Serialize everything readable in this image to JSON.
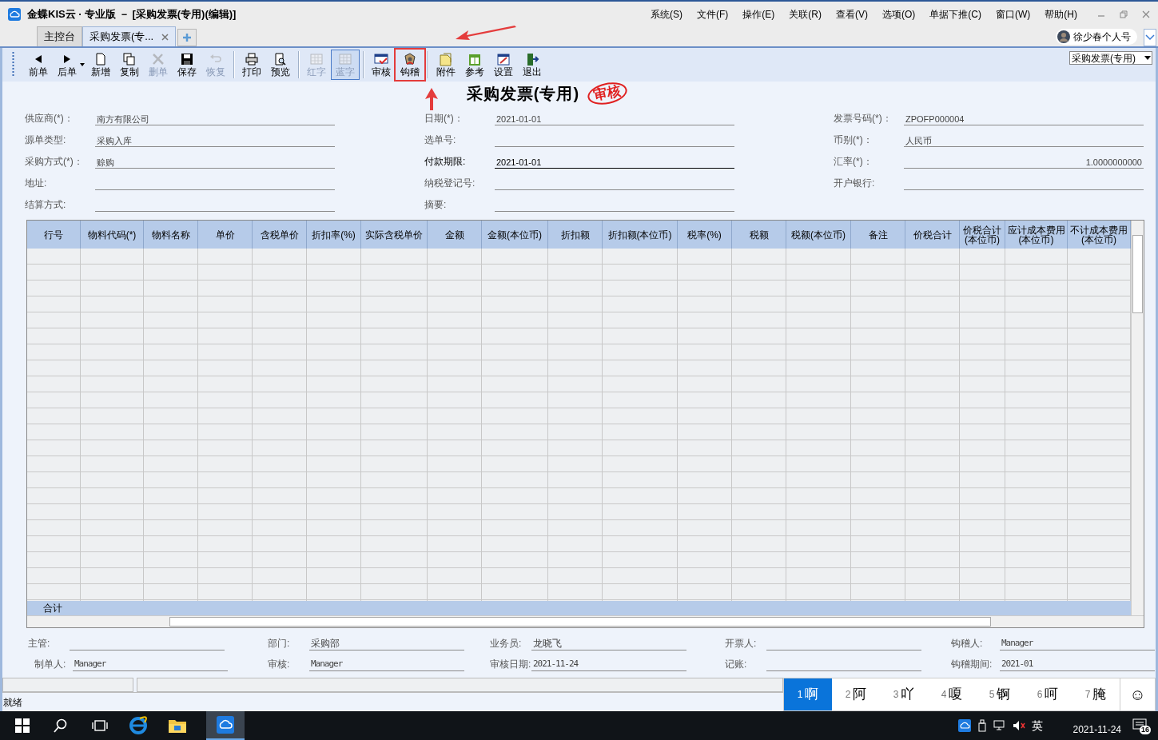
{
  "window": {
    "title": "金蝶KIS云 · 专业版 － [采购发票(专用)(编辑)]"
  },
  "menu": [
    "系统(S)",
    "文件(F)",
    "操作(E)",
    "关联(R)",
    "查看(V)",
    "选项(O)",
    "单据下推(C)",
    "窗口(W)",
    "帮助(H)"
  ],
  "tabs": [
    {
      "label": "主控台",
      "selected": false,
      "closable": false
    },
    {
      "label": "采购发票(专...",
      "selected": true,
      "closable": true
    }
  ],
  "user": {
    "name": "徐少春个人号"
  },
  "toolbar": {
    "groups": [
      [
        {
          "label": "前单",
          "disabled": false,
          "pressed": false,
          "highlighted": false
        },
        {
          "label": "后单",
          "disabled": false,
          "pressed": false,
          "highlighted": false,
          "dropdown": true
        },
        {
          "label": "新增",
          "disabled": false,
          "pressed": false,
          "highlighted": false
        },
        {
          "label": "复制",
          "disabled": false,
          "pressed": false,
          "highlighted": false
        },
        {
          "label": "删单",
          "disabled": true,
          "pressed": false,
          "highlighted": false
        },
        {
          "label": "保存",
          "disabled": false,
          "pressed": false,
          "highlighted": false
        },
        {
          "label": "恢复",
          "disabled": true,
          "pressed": false,
          "highlighted": false
        }
      ],
      [
        {
          "label": "打印",
          "disabled": false,
          "pressed": false,
          "highlighted": false
        },
        {
          "label": "预览",
          "disabled": false,
          "pressed": false,
          "highlighted": false
        }
      ],
      [
        {
          "label": "红字",
          "disabled": true,
          "pressed": false,
          "highlighted": false
        },
        {
          "label": "蓝字",
          "disabled": true,
          "pressed": true,
          "highlighted": false
        }
      ],
      [
        {
          "label": "审核",
          "disabled": false,
          "pressed": false,
          "highlighted": false
        },
        {
          "label": "钩稽",
          "disabled": false,
          "pressed": false,
          "highlighted": true
        }
      ],
      [
        {
          "label": "附件",
          "disabled": false,
          "pressed": false,
          "highlighted": false
        },
        {
          "label": "参考",
          "disabled": false,
          "pressed": false,
          "highlighted": false
        },
        {
          "label": "设置",
          "disabled": false,
          "pressed": false,
          "highlighted": false
        },
        {
          "label": "退出",
          "disabled": false,
          "pressed": false,
          "highlighted": false
        }
      ]
    ],
    "type_select": "采购发票(专用)"
  },
  "document": {
    "title": "采购发票(专用)",
    "stamp": "审核"
  },
  "form": {
    "columns": [
      [
        {
          "label": "供应商(*)：",
          "value": "南方有限公司"
        },
        {
          "label": "源单类型:",
          "value": "采购入库"
        },
        {
          "label": "采购方式(*)：",
          "value": "赊购"
        },
        {
          "label": "地址:"
        },
        {
          "label": "结算方式:"
        }
      ],
      [
        {
          "label": "日期(*)：",
          "value": "2021-01-01"
        },
        {
          "label": "选单号:"
        },
        {
          "label": "付款期限:",
          "value": "2021-01-01",
          "emphasis": true
        },
        {
          "label": "纳税登记号:"
        },
        {
          "label": "摘要:"
        }
      ],
      [
        {
          "label": "发票号码(*)：",
          "value": "ZPOFP000004"
        },
        {
          "label": "币别(*)：",
          "value": "人民币"
        },
        {
          "label": "汇率(*)：",
          "value": "1.0000000000",
          "right_aligned": true
        },
        {
          "label": "开户银行:"
        }
      ]
    ]
  },
  "table": {
    "columns": [
      "行号",
      "物料代码(*)",
      "物料名称",
      "单价",
      "含税单价",
      "折扣率(%)",
      "实际含税单价",
      "金额",
      "金额(本位币)",
      "折扣额",
      "折扣额(本位币)",
      "税率(%)",
      "税额",
      "税额(本位币)",
      "备注",
      "价税合计",
      "价税合计(本位币)",
      "应计成本费用(本位币)",
      "不计成本费用(本位币)"
    ],
    "total_label": "合计"
  },
  "footer": [
    [
      {
        "label": "主管:"
      },
      {
        "label": "部门:",
        "value": "采购部"
      },
      {
        "label": "业务员:",
        "value": "龙晓飞"
      },
      {
        "label": "开票人:"
      },
      {
        "label": "钩稽人:",
        "value": "Manager"
      }
    ],
    [
      {
        "label": "制单人:",
        "value": "Manager"
      },
      {
        "label": "审核:",
        "value": "Manager"
      },
      {
        "label": "审核日期:",
        "value": "2021-11-24"
      },
      {
        "label": "记账:"
      },
      {
        "label": "钩稽期间:",
        "value": "2021-01"
      }
    ]
  ],
  "status_bar": {
    "text": "就绪"
  },
  "ime": {
    "candidates": [
      {
        "index": "1",
        "text": "啊",
        "selected": true
      },
      {
        "index": "2",
        "text": "阿",
        "selected": false
      },
      {
        "index": "3",
        "text": "吖",
        "selected": false
      },
      {
        "index": "4",
        "text": "嗄",
        "selected": false
      },
      {
        "index": "5",
        "text": "锕",
        "selected": false
      },
      {
        "index": "6",
        "text": "呵",
        "selected": false
      },
      {
        "index": "7",
        "text": "腌",
        "selected": false
      }
    ],
    "emoji": "☺"
  },
  "taskbar": {
    "ime_mode": "英",
    "date": "2021-11-24",
    "badge": "16"
  }
}
